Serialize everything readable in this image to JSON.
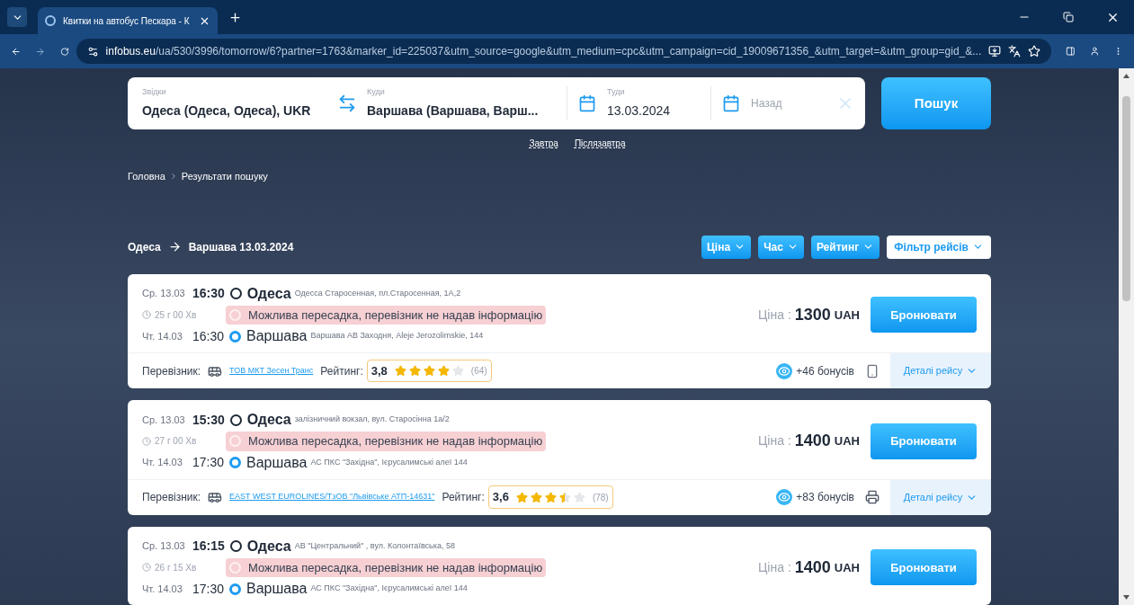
{
  "browser": {
    "tab_title": "Квитки на автобус Пескара - К",
    "url_host": "infobus.eu",
    "url_path": "/ua/530/3996/tomorrow/6?partner=1763&marker_id=225037&utm_source=google&utm_medium=cpc&utm_campaign=cid_19009671356_&utm_target=&utm_group=gid_&..."
  },
  "search": {
    "from": {
      "label": "Звідки",
      "value": "Одеса (Одеса,  Одеса), UKR"
    },
    "to": {
      "label": "Куди",
      "value": "Варшава (Варшава,  Варш..."
    },
    "depart": {
      "label": "Туди",
      "value": "13.03.2024"
    },
    "return": {
      "placeholder": "Назад"
    },
    "button": "Пошук"
  },
  "quick_dates": [
    "Завтра",
    "Післязавтра"
  ],
  "breadcrumbs": [
    "Головна",
    "Результати пошуку"
  ],
  "route": {
    "from": "Одеса",
    "to": "Варшава 13.03.2024"
  },
  "sort_buttons": [
    {
      "label": "Ціна",
      "kind": "sort"
    },
    {
      "label": "Час",
      "kind": "sort"
    },
    {
      "label": "Рейтинг",
      "kind": "sort"
    },
    {
      "label": "Фільтр рейсів",
      "kind": "filter"
    }
  ],
  "trips": [
    {
      "dep_date": "Ср. 13.03",
      "dep_time": "16:30",
      "dep_city": "Одеса",
      "dep_stop": "Одесса Старосенная, пл.Старосенная, 1А,2",
      "duration": "25 г 00 Хв",
      "notice": "Можлива пересадка, перевізник не надав інформацію",
      "arr_date": "Чт. 14.03",
      "arr_time": "16:30",
      "arr_city": "Варшава",
      "arr_stop": "Варшава АВ Заходня, Aleje Jerozolimskie, 144",
      "price_label": "Ціна :",
      "price": "1300",
      "currency": "UAH",
      "book": "Бронювати",
      "carrier_label": "Перевізник:",
      "carrier": "ТОВ МКТ Зесен Транс",
      "rating_label": "Рейтинг:",
      "rating": "3,8",
      "stars": 4,
      "reviews": "(64)",
      "bonus": "+46 бонусів",
      "ticket": {
        "kind": "phone"
      },
      "details": "Деталі рейсу"
    },
    {
      "dep_date": "Ср. 13.03",
      "dep_time": "15:30",
      "dep_city": "Одеса",
      "dep_stop": "залізничний вокзал, вул. Старосінна 1а/2",
      "duration": "27 г 00 Хв",
      "notice": "Можлива пересадка, перевізник не надав інформацію",
      "arr_date": "Чт. 14.03",
      "arr_time": "17:30",
      "arr_city": "Варшава",
      "arr_stop": "АС ПКС \"Західна\", Ієрусалимські алеї 144",
      "price_label": "Ціна :",
      "price": "1400",
      "currency": "UAH",
      "book": "Бронювати",
      "carrier_label": "Перевізник:",
      "carrier": "EAST WEST EUROLINES/ТзОВ \"Львівське АТП-14631\"",
      "rating_label": "Рейтинг:",
      "rating": "3,6",
      "stars": 3.5,
      "reviews": "(78)",
      "bonus": "+83 бонусів",
      "ticket": {
        "kind": "print"
      },
      "details": "Деталі рейсу"
    },
    {
      "dep_date": "Ср. 13.03",
      "dep_time": "16:15",
      "dep_city": "Одеса",
      "dep_stop": "АВ \"Центральний\" , вул. Колонтаївська, 58",
      "duration": "26 г 15 Хв",
      "notice": "Можлива пересадка, перевізник не надав інформацію",
      "arr_date": "Чт. 14.03",
      "arr_time": "17:30",
      "arr_city": "Варшава",
      "arr_stop": "АС ПКС \"Західна\", Ієрусалимські алеї 144",
      "price_label": "Ціна :",
      "price": "1400",
      "currency": "UAH",
      "book": "Бронювати"
    }
  ]
}
